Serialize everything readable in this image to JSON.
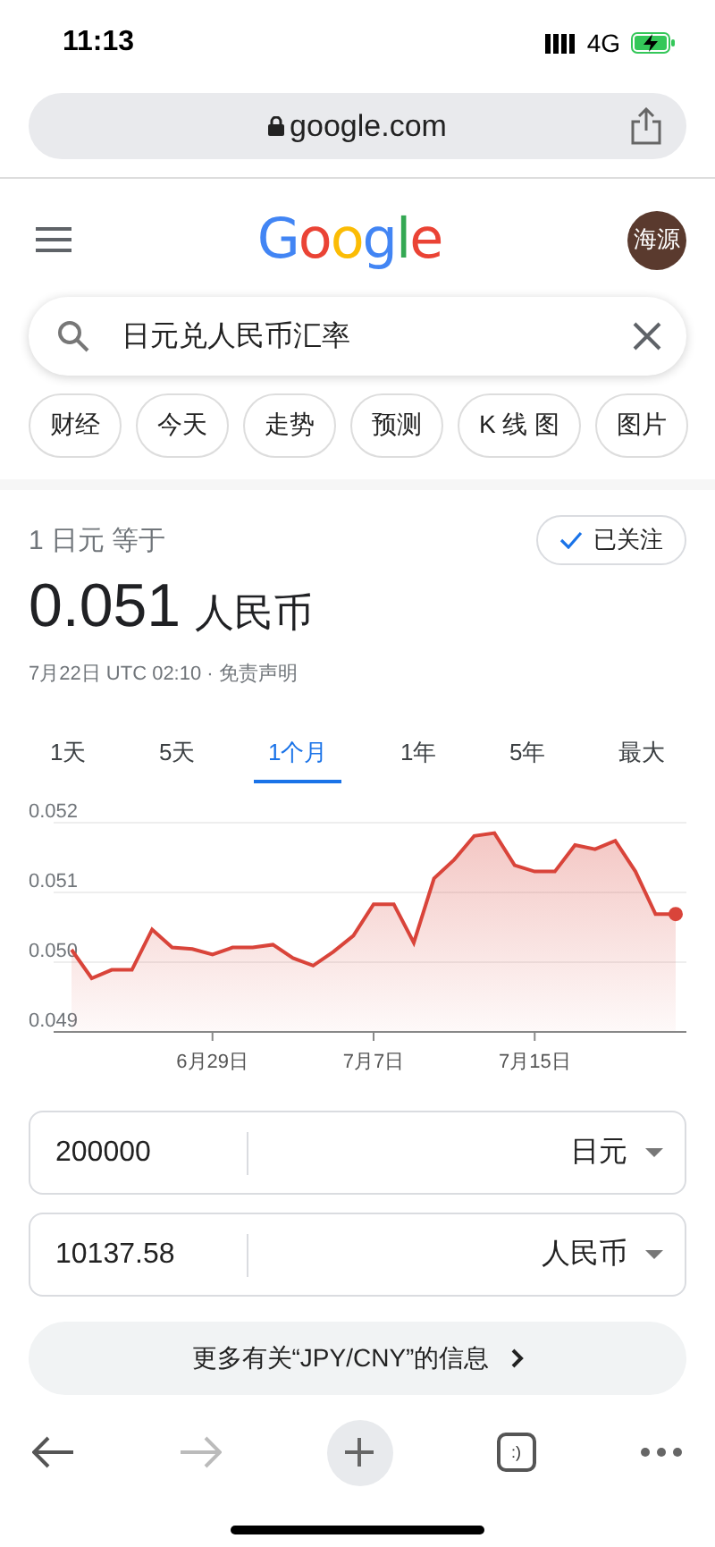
{
  "status_bar": {
    "time": "11:13",
    "network": "4G"
  },
  "address_bar": {
    "url": "google.com"
  },
  "header": {
    "logo": "Google",
    "avatar_text": "海源"
  },
  "search": {
    "value": "日元兑人民币汇率"
  },
  "chips": [
    "财经",
    "今天",
    "走势",
    "预测",
    "K 线 图",
    "图片"
  ],
  "rate": {
    "base": "1 日元 等于",
    "value": "0.051",
    "unit": "人民币",
    "timestamp": "7月22日 UTC 02:10 ·",
    "disclaimer": "免责声明",
    "follow": {
      "label": "已关注",
      "checked": true
    }
  },
  "ranges": [
    {
      "label": "1天",
      "selected": false
    },
    {
      "label": "5天",
      "selected": false
    },
    {
      "label": "1个月",
      "selected": true
    },
    {
      "label": "1年",
      "selected": false
    },
    {
      "label": "5年",
      "selected": false
    },
    {
      "label": "最大",
      "selected": false
    }
  ],
  "chart_data": {
    "type": "area",
    "categories": [
      null,
      null,
      null,
      null,
      null,
      null,
      null,
      "6月29日",
      null,
      null,
      null,
      null,
      null,
      null,
      null,
      "7月7日",
      null,
      null,
      null,
      null,
      null,
      null,
      null,
      "7月15日",
      null,
      null,
      null,
      null,
      null,
      null,
      null
    ],
    "series": [
      {
        "color": "#d9443a",
        "values": [
          0.05018,
          0.04977,
          0.04989,
          0.04989,
          0.05047,
          0.05021,
          0.05019,
          0.05011,
          0.05021,
          0.05021,
          0.05025,
          0.05006,
          0.04995,
          0.05015,
          0.05038,
          0.05083,
          0.05083,
          0.05028,
          0.0512,
          0.05147,
          0.05181,
          0.05185,
          0.05139,
          0.0513,
          0.0513,
          0.05168,
          0.05162,
          0.05174,
          0.0513,
          0.05069,
          0.05069
        ]
      }
    ],
    "ylim": [
      0.049,
      0.052
    ],
    "yticks": [
      {
        "value": 0.049,
        "label": "0.049"
      },
      {
        "value": 0.05,
        "label": "0.050"
      },
      {
        "value": 0.051,
        "label": "0.051"
      },
      {
        "value": 0.052,
        "label": "0.052"
      }
    ]
  },
  "converter": [
    {
      "amount": "200000",
      "currency": "日元"
    },
    {
      "amount": "10137.58",
      "currency": "人民币"
    }
  ],
  "more_link": "更多有关“JPY/CNY”的信息",
  "toolbar": {
    "back_disabled": false,
    "forward_disabled": true,
    "tabs_label": ":)"
  }
}
